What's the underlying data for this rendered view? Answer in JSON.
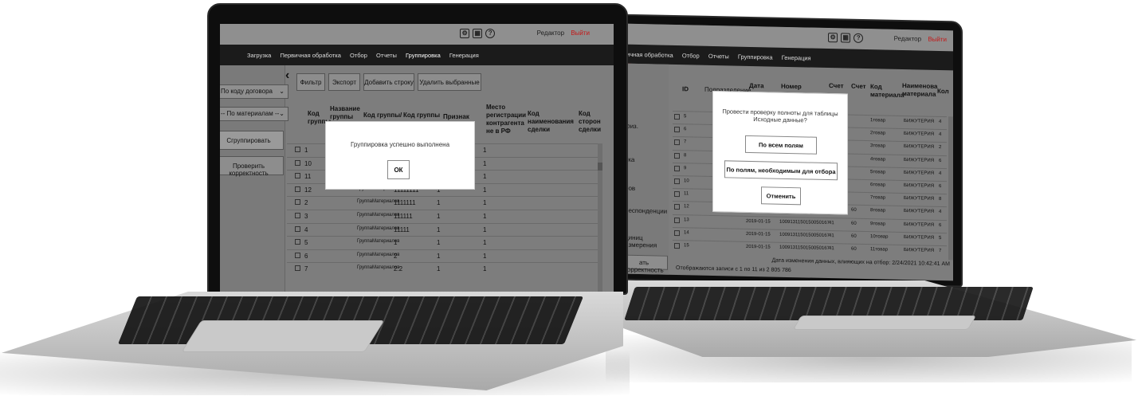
{
  "left_screen": {
    "toolbar_icons": [
      "gear-icon",
      "building-icon",
      "help-icon"
    ],
    "help_glyph": "?",
    "editor_label": "Редактор",
    "logout_label": "Выйти",
    "menu": [
      "Загрузка",
      "Первичная обработка",
      "Отбор",
      "Отчеты",
      "Группировка",
      "Генерация"
    ],
    "sidebar": {
      "select_contract": "По коду договора",
      "select_materials": "-- По материалам --",
      "group_button": "Сгруппировать",
      "check_button": "Проверить корректность"
    },
    "collapse_glyph": "‹",
    "toolbar_buttons": [
      "Фильтр",
      "Экспорт",
      "Добавить строку",
      "Удалить выбранные"
    ],
    "columns": [
      "Код группы",
      "Название группы",
      "Код группы/",
      "Код группы",
      "Признак",
      "Место регистрации контрагента не в РФ",
      "Код наименования сделки",
      "Код сторон сделки"
    ],
    "rows": [
      {
        "id": "1",
        "name": "",
        "code1": "",
        "code2": "",
        "flag": "",
        "place": "1"
      },
      {
        "id": "10",
        "name": "",
        "code1": "",
        "code2": "",
        "flag": "",
        "place": "1"
      },
      {
        "id": "11",
        "name": "",
        "code1": "",
        "code2": "",
        "flag": "",
        "place": "1"
      },
      {
        "id": "12",
        "name": "ГруппаМатериалов",
        "code1": "11111111",
        "code2": "",
        "flag": "1",
        "place": "1"
      },
      {
        "id": "2",
        "name": "ГруппаМатериалов",
        "code1": "1111111",
        "code2": "",
        "flag": "1",
        "place": "1"
      },
      {
        "id": "3",
        "name": "ГруппаМатериалов",
        "code1": "111111",
        "code2": "",
        "flag": "1",
        "place": "1"
      },
      {
        "id": "4",
        "name": "ГруппаМатериалов",
        "code1": "11111",
        "code2": "",
        "flag": "1",
        "place": "1"
      },
      {
        "id": "5",
        "name": "ГруппаМатериалов",
        "code1": "1",
        "code2": "",
        "flag": "1",
        "place": "1"
      },
      {
        "id": "6",
        "name": "ГруппаМатериалов",
        "code1": "2",
        "code2": "",
        "flag": "1",
        "place": "1"
      },
      {
        "id": "7",
        "name": "ГруппаМатериалов",
        "code1": "2.2",
        "code2": "",
        "flag": "1",
        "place": "1"
      }
    ],
    "modal": {
      "message": "Группировка успешно выполнена",
      "ok": "ОК"
    }
  },
  "right_screen": {
    "help_glyph": "?",
    "editor_label": "Редактор",
    "logout_label": "Выйти",
    "menu": [
      "ичная обработка",
      "Отбор",
      "Отчеты",
      "Группировка",
      "Генерация"
    ],
    "columns": [
      "ID",
      "Подразделение",
      "Дата",
      "Номер",
      "Счет",
      "Счет",
      "Код материала",
      "Наименова материала",
      "Кол"
    ],
    "left_fragments": [
      "физ.",
      "вка",
      "ров",
      "респонденции",
      "диниц измерения"
    ],
    "check_button": "ать корректность",
    "rows": [
      {
        "id": "5",
        "date": "",
        "number": "",
        "acc1": "",
        "acc2": "",
        "code": "1товар",
        "name": "БИЖУТЕРИЯ",
        "qty": "4"
      },
      {
        "id": "6",
        "date": "",
        "number": "",
        "acc1": "",
        "acc2": "",
        "code": "2товар",
        "name": "БИЖУТЕРИЯ",
        "qty": "4"
      },
      {
        "id": "7",
        "date": "",
        "number": "",
        "acc1": "",
        "acc2": "",
        "code": "3товар",
        "name": "БИЖУТЕРИЯ",
        "qty": "2"
      },
      {
        "id": "8",
        "date": "",
        "number": "",
        "acc1": "",
        "acc2": "",
        "code": "4товар",
        "name": "БИЖУТЕРИЯ",
        "qty": "6"
      },
      {
        "id": "9",
        "date": "",
        "number": "",
        "acc1": "",
        "acc2": "",
        "code": "5товар",
        "name": "БИЖУТЕРИЯ",
        "qty": "4"
      },
      {
        "id": "10",
        "date": "",
        "number": "",
        "acc1": "",
        "acc2": "",
        "code": "6товар",
        "name": "БИЖУТЕРИЯ",
        "qty": "6"
      },
      {
        "id": "11",
        "date": "",
        "number": "",
        "acc1": "",
        "acc2": "",
        "code": "7товар",
        "name": "БИЖУТЕРИЯ",
        "qty": "8"
      },
      {
        "id": "12",
        "date": "2019-01-15",
        "number": "1009131150150050167",
        "acc1": "41",
        "acc2": "60",
        "code": "8товар",
        "name": "БИЖУТЕРИЯ",
        "qty": "4"
      },
      {
        "id": "13",
        "date": "2019-01-15",
        "number": "1009131150150050167",
        "acc1": "41",
        "acc2": "60",
        "code": "9товар",
        "name": "БИЖУТЕРИЯ",
        "qty": "6"
      },
      {
        "id": "14",
        "date": "2019-01-15",
        "number": "1009131150150050167",
        "acc1": "41",
        "acc2": "60",
        "code": "10товар",
        "name": "БИЖУТЕРИЯ",
        "qty": "5"
      },
      {
        "id": "15",
        "date": "2019-01-15",
        "number": "1009131150150050167",
        "acc1": "41",
        "acc2": "60",
        "code": "11товар",
        "name": "БИЖУТЕРИЯ",
        "qty": "7"
      }
    ],
    "footer_left": "Отображаются записи с 1 по 11 из 2 805 786",
    "footer_right": "Дата изменения данных, влияющих на отбор: 2/24/2021 10:42:41 AM",
    "modal": {
      "message": "Провести проверку полноты для таблицы Исходные данные?",
      "btn_all": "По всем полям",
      "btn_required": "По полям, необходимым для отбора",
      "btn_cancel": "Отменить"
    }
  }
}
